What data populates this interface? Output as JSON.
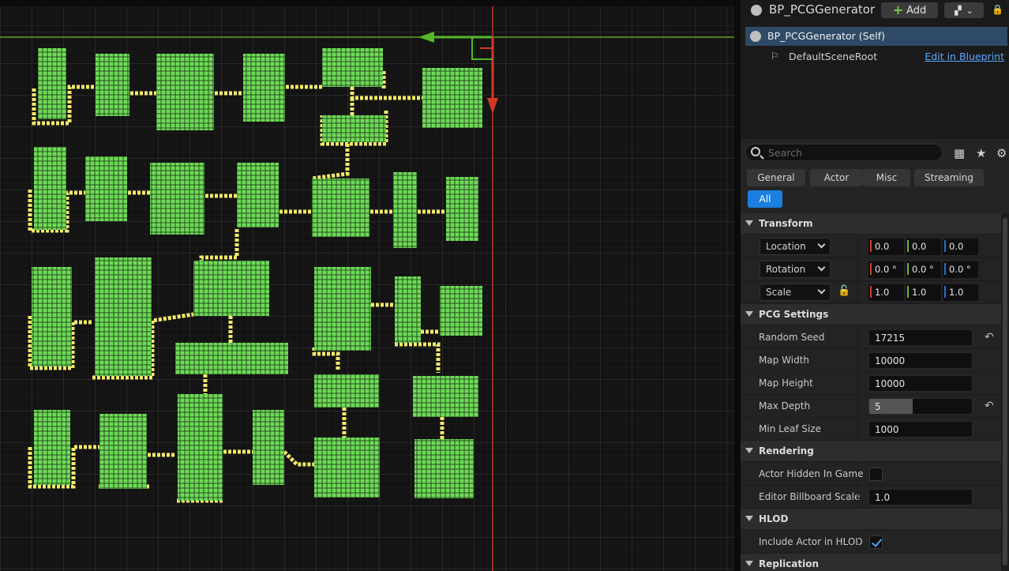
{
  "actor": {
    "title": "BP_PCGGenerator",
    "add_label": "Add",
    "self_label": "BP_PCGGenerator (Self)",
    "root_label": "DefaultSceneRoot",
    "edit_link": "Edit in Blueprint"
  },
  "search": {
    "placeholder": "Search"
  },
  "filter_tabs": [
    "General",
    "Actor",
    "Misc",
    "Streaming",
    "All"
  ],
  "active_tab": "All",
  "sections": {
    "transform": "Transform",
    "pcg": "PCG Settings",
    "rendering": "Rendering",
    "hlod": "HLOD",
    "replication": "Replication"
  },
  "transform": {
    "location": {
      "label": "Location",
      "x": "0.0",
      "y": "0.0",
      "z": "0.0"
    },
    "rotation": {
      "label": "Rotation",
      "x": "0.0 °",
      "y": "0.0 °",
      "z": "0.0 °"
    },
    "scale": {
      "label": "Scale",
      "x": "1.0",
      "y": "1.0",
      "z": "1.0"
    }
  },
  "pcg": {
    "random_seed": {
      "label": "Random Seed",
      "value": "17215"
    },
    "map_width": {
      "label": "Map Width",
      "value": "10000"
    },
    "map_height": {
      "label": "Map Height",
      "value": "10000"
    },
    "max_depth": {
      "label": "Max Depth",
      "value": "5",
      "fill_fraction": 0.42
    },
    "min_leaf_size": {
      "label": "Min Leaf Size",
      "value": "1000"
    }
  },
  "rendering": {
    "actor_hidden": {
      "label": "Actor Hidden In Game",
      "checked": false
    },
    "billboard_scale": {
      "label": "Editor Billboard Scale",
      "value": "1.0"
    }
  },
  "hlod": {
    "include_actor": {
      "label": "Include Actor in HLOD",
      "checked": true
    }
  },
  "colors": {
    "room_fill": "#6ddc57",
    "corridor": "#f3ea6a",
    "gizmo_x": "#d33a22",
    "gizmo_y": "#55b62a",
    "selection": "#2e4a66",
    "accent": "#1a7fe0"
  },
  "icons": {
    "actor": "actor-sphere-icon",
    "root": "scene-root-icon",
    "search": "search-icon",
    "table": "table-view-icon",
    "favorite": "star-icon",
    "settings": "gear-icon",
    "lock": "lock-icon",
    "reset": "reset-arrow-icon"
  }
}
